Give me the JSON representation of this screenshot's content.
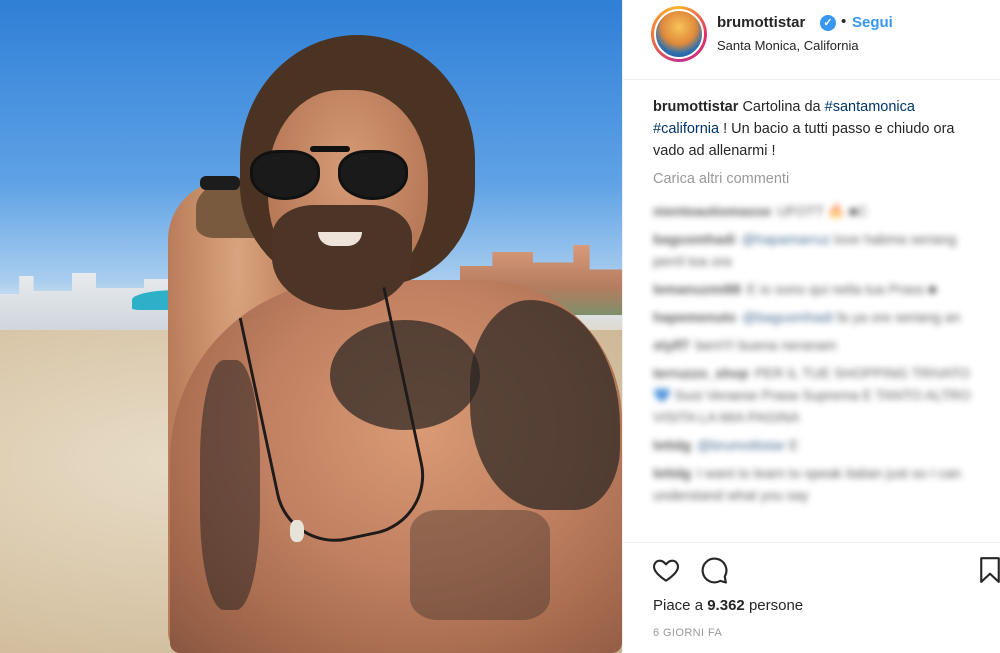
{
  "post": {
    "username": "brumottistar",
    "verified_symbol": "✓",
    "separator": "•",
    "follow_label": "Segui",
    "location": "Santa Monica, California",
    "caption": {
      "user": "brumottistar",
      "text_before": "Cartolina da",
      "hashtag1": "#santamonica",
      "hashtag2": "#california",
      "text_after": "! Un bacio a tutti passo e chiudo ora vado ad allenarmi !"
    },
    "load_more_label": "Carica altri commenti",
    "comments": [
      {
        "user": "nienteautiomasse",
        "text": "UFOTT 🔥 ■C"
      },
      {
        "user": "bagusmhadi",
        "mention": "@hapamarruz",
        "text": "love habma seriang perril toa ora"
      },
      {
        "user": "lemanuzmi88",
        "text": "E io sono qui nella tua Prass ■"
      },
      {
        "user": "hapemenuto",
        "mention": "@bagusmhadi",
        "text": "fa ya ore seriang an"
      },
      {
        "user": "stylf7",
        "text": "ben!!!! buena neranam"
      },
      {
        "user": "terruzzo_shop",
        "text": "PER IL TUE SHOPPING TRIVATO 💙 Suoi Veraese Prasa Suprema E TANTO ALTRO VISITA LA MIA PAGINA"
      },
      {
        "user": "lettdg",
        "mention": "@brumottistar",
        "text": "E"
      },
      {
        "user": "lettdg",
        "text": "I want to learn to speak italian just so I can understand what you say"
      }
    ],
    "likes_label": "Piace a",
    "likes_count": "9.362",
    "likes_suffix": "persone",
    "time_ago": "6 GIORNI FA"
  },
  "colors": {
    "link_blue": "#3897f0",
    "hashtag": "#003569",
    "muted": "#999999",
    "text": "#262626"
  },
  "icons": {
    "like": "heart-icon",
    "comment": "comment-bubble-icon",
    "save": "bookmark-icon",
    "verified": "verified-badge-icon"
  }
}
